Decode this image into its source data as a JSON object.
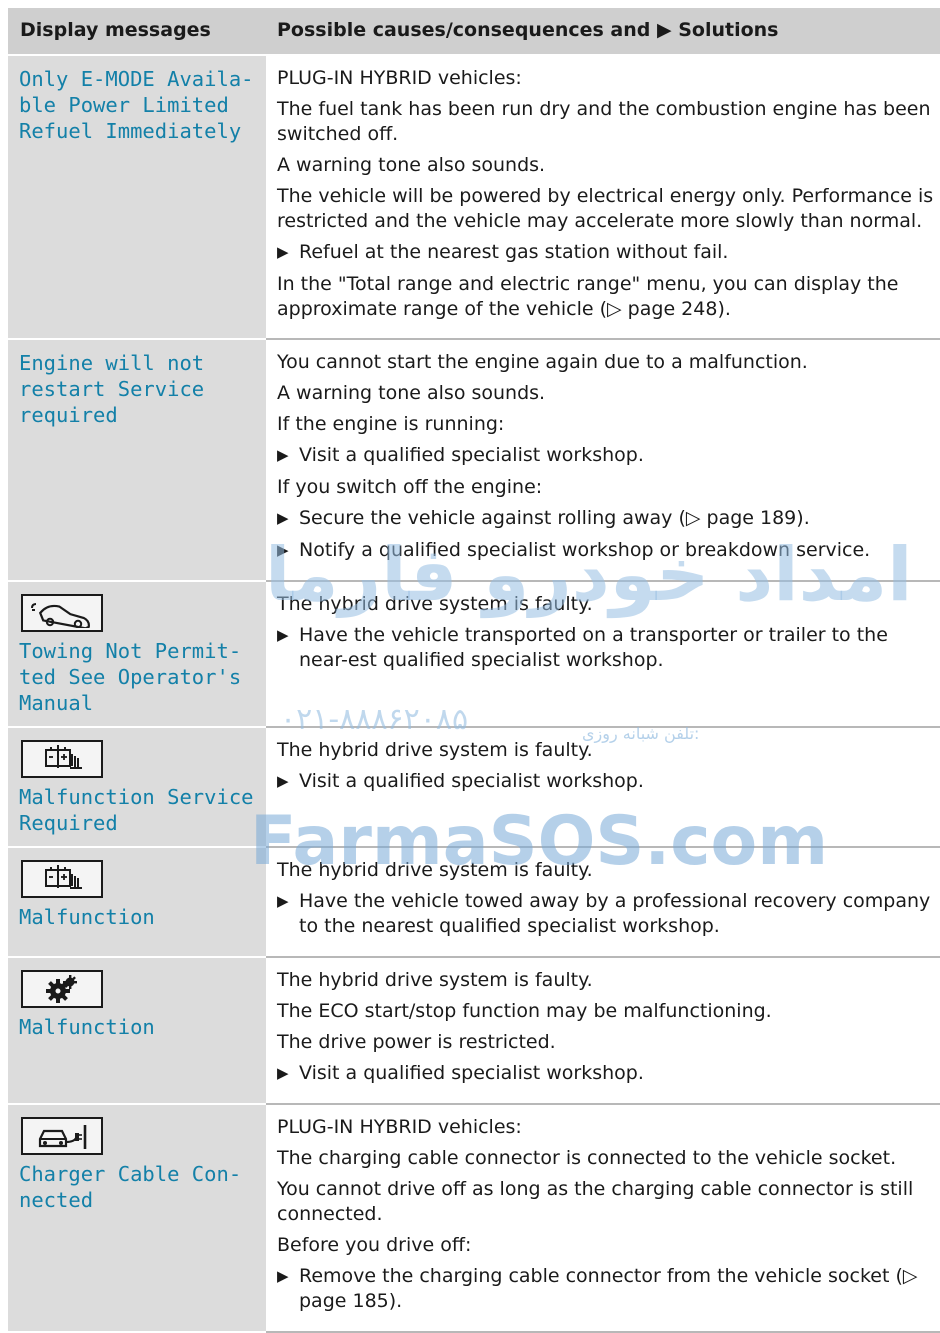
{
  "header": {
    "col1": "Display messages",
    "col2": "Possible causes/consequences and ▶ Solutions"
  },
  "rows": [
    {
      "message": "Only E-MODE Availa-\nble Power Limited\nRefuel Immediately",
      "icon": null,
      "lines": [
        {
          "type": "text",
          "text": "PLUG-IN HYBRID vehicles:"
        },
        {
          "type": "text",
          "text": "The fuel tank has been run dry and the combustion engine has been switched off."
        },
        {
          "type": "text",
          "text": "A warning tone also sounds."
        },
        {
          "type": "text",
          "text": "The vehicle will be powered by electrical energy only. Performance is restricted and the vehicle may accelerate more slowly than normal."
        },
        {
          "type": "step",
          "text": "Refuel at the nearest gas station without fail."
        },
        {
          "type": "text",
          "text": "In the \"Total range and electric range\" menu, you can display the approximate range of the vehicle (▷ page 248)."
        }
      ]
    },
    {
      "message": "Engine will not\nrestart Service\nrequired",
      "icon": null,
      "lines": [
        {
          "type": "text",
          "text": "You cannot start the engine again due to a malfunction."
        },
        {
          "type": "text",
          "text": "A warning tone also sounds."
        },
        {
          "type": "text",
          "text": "If the engine is running:"
        },
        {
          "type": "step",
          "text": "Visit a qualified specialist workshop."
        },
        {
          "type": "text",
          "text": "If you switch off the engine:"
        },
        {
          "type": "step",
          "text": "Secure the vehicle against rolling away (▷ page 189)."
        },
        {
          "type": "step",
          "text": "Notify a qualified specialist workshop or breakdown service."
        }
      ]
    },
    {
      "message": "Towing Not Permit-\nted See Operator's\nManual",
      "icon": "towing-car-icon",
      "lines": [
        {
          "type": "text",
          "text": "The hybrid drive system is faulty."
        },
        {
          "type": "step",
          "text": "Have the vehicle transported on a transporter or trailer to the near-est qualified specialist workshop."
        }
      ]
    },
    {
      "message": "Malfunction Service\nRequired",
      "icon": "battery-icon",
      "lines": [
        {
          "type": "text",
          "text": "The hybrid drive system is faulty."
        },
        {
          "type": "step",
          "text": "Visit a qualified specialist workshop."
        }
      ]
    },
    {
      "message": "Malfunction",
      "icon": "battery-icon",
      "lines": [
        {
          "type": "text",
          "text": "The hybrid drive system is faulty."
        },
        {
          "type": "step",
          "text": "Have the vehicle towed away by a professional recovery company to the nearest qualified specialist workshop."
        }
      ]
    },
    {
      "message": "Malfunction",
      "icon": "gear-icon",
      "lines": [
        {
          "type": "text",
          "text": "The hybrid drive system is faulty."
        },
        {
          "type": "text",
          "text": "The ECO start/stop function may be malfunctioning."
        },
        {
          "type": "text",
          "text": "The drive power is restricted."
        },
        {
          "type": "step",
          "text": "Visit a qualified specialist workshop."
        }
      ]
    },
    {
      "message": "Charger Cable Con-\nnected",
      "icon": "charging-car-icon",
      "lines": [
        {
          "type": "text",
          "text": "PLUG-IN HYBRID vehicles:"
        },
        {
          "type": "text",
          "text": "The charging cable connector is connected to the vehicle socket."
        },
        {
          "type": "text",
          "text": "You cannot drive off as long as the charging cable connector is still connected."
        },
        {
          "type": "text",
          "text": "Before you drive off:"
        },
        {
          "type": "step",
          "text": "Remove the charging cable connector from the vehicle socket (▷ page 185)."
        }
      ]
    }
  ],
  "watermark": {
    "arabic_title": "امداد خودرو فارما",
    "phone": "۰۲۱-۸۸۸۶۲۰۸۵",
    "phone_label": "تلفن شبانه روزی:",
    "site": "FarmaSOS.com"
  }
}
